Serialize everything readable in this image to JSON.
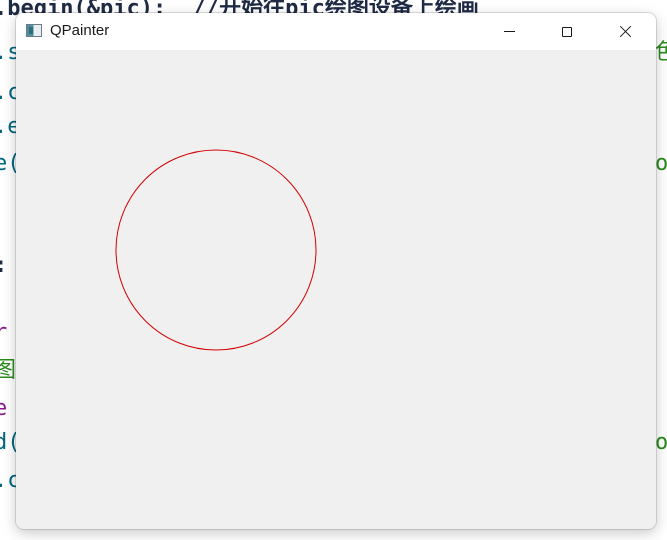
{
  "background_code": {
    "lines": [
      {
        "text": ".begin(&pic);  //开始往pic绘图设备上绘画",
        "color": "#1f2a44"
      },
      {
        "text": ".s",
        "color": "#00677c"
      },
      {
        "text": ".c",
        "color": "#00677c"
      },
      {
        "text": ".e",
        "color": "#00677c"
      },
      {
        "text": "e(",
        "color": "#00677c"
      },
      {
        "text": ": :",
        "color": "#1f2a44"
      },
      {
        "text": "r",
        "color": "#8a1b8e"
      },
      {
        "text": "图",
        "color": "#2b8a1e"
      },
      {
        "text": "e",
        "color": "#8a1b8e"
      },
      {
        "text": "d(",
        "color": "#00677c"
      },
      {
        "text": ".c",
        "color": "#00677c"
      }
    ],
    "right_fragments": [
      {
        "text": "色",
        "color": "#2b8a1e"
      },
      {
        "text": "o",
        "color": "#2b8a1e"
      },
      {
        "text": "o",
        "color": "#2b8a1e"
      }
    ]
  },
  "window": {
    "title": "QPainter",
    "icon": "qt-window-icon",
    "buttons": {
      "minimize": "minimize-icon",
      "maximize": "maximize-icon",
      "close": "close-icon"
    },
    "background_color": "#f0f0f0"
  },
  "drawing": {
    "shape": "circle",
    "stroke_color": "#d40000",
    "fill": "none"
  }
}
